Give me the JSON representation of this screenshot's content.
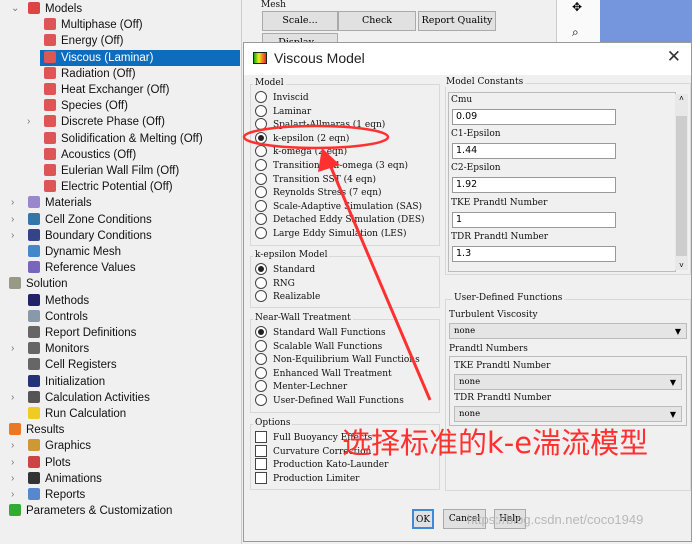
{
  "tree": {
    "items": [
      {
        "label": "Models",
        "icon": "models-icon",
        "indent": 1,
        "chev": "v"
      },
      {
        "label": "Multiphase (Off)",
        "icon": "model-icon",
        "indent": 2
      },
      {
        "label": "Energy (Off)",
        "icon": "model-icon",
        "indent": 2
      },
      {
        "label": "Viscous (Laminar)",
        "icon": "model-icon",
        "indent": 2,
        "selected": true
      },
      {
        "label": "Radiation (Off)",
        "icon": "model-icon",
        "indent": 2
      },
      {
        "label": "Heat Exchanger (Off)",
        "icon": "model-icon",
        "indent": 2
      },
      {
        "label": "Species (Off)",
        "icon": "model-icon",
        "indent": 2
      },
      {
        "label": "Discrete Phase (Off)",
        "icon": "model-icon",
        "indent": 2,
        "chev": ">"
      },
      {
        "label": "Solidification & Melting (Off)",
        "icon": "model-icon",
        "indent": 2
      },
      {
        "label": "Acoustics (Off)",
        "icon": "model-icon",
        "indent": 2
      },
      {
        "label": "Eulerian Wall Film (Off)",
        "icon": "model-icon",
        "indent": 2
      },
      {
        "label": "Electric Potential (Off)",
        "icon": "model-icon",
        "indent": 2
      },
      {
        "label": "Materials",
        "icon": "materials-flask-icon",
        "indent": 1,
        "chev": ">"
      },
      {
        "label": "Cell Zone Conditions",
        "icon": "cell-zone-icon",
        "indent": 1,
        "chev": ">"
      },
      {
        "label": "Boundary Conditions",
        "icon": "boundary-icon",
        "indent": 1,
        "chev": ">"
      },
      {
        "label": "Dynamic Mesh",
        "icon": "dynamic-mesh-icon",
        "indent": 1
      },
      {
        "label": "Reference Values",
        "icon": "reference-values-icon",
        "indent": 1
      },
      {
        "label": "Solution",
        "icon": "solution-icon",
        "indent": 0,
        "chev": "v"
      },
      {
        "label": "Methods",
        "icon": "methods-icon",
        "indent": 1
      },
      {
        "label": "Controls",
        "icon": "controls-icon",
        "indent": 1
      },
      {
        "label": "Report Definitions",
        "icon": "report-icon",
        "indent": 1
      },
      {
        "label": "Monitors",
        "icon": "monitors-icon",
        "indent": 1,
        "chev": ">"
      },
      {
        "label": "Cell Registers",
        "icon": "cell-registers-icon",
        "indent": 1
      },
      {
        "label": "Initialization",
        "icon": "initialization-icon",
        "indent": 1
      },
      {
        "label": "Calculation Activities",
        "icon": "calc-activities-icon",
        "indent": 1,
        "chev": ">"
      },
      {
        "label": "Run Calculation",
        "icon": "lightning-icon",
        "indent": 1
      },
      {
        "label": "Results",
        "icon": "results-icon",
        "indent": 0,
        "chev": "v"
      },
      {
        "label": "Graphics",
        "icon": "graphics-icon",
        "indent": 1,
        "chev": ">"
      },
      {
        "label": "Plots",
        "icon": "plots-icon",
        "indent": 1,
        "chev": ">"
      },
      {
        "label": "Animations",
        "icon": "animations-icon",
        "indent": 1,
        "chev": ">"
      },
      {
        "label": "Reports",
        "icon": "reports-icon",
        "indent": 1,
        "chev": ">"
      },
      {
        "label": "Parameters & Customization",
        "icon": "parameters-icon",
        "indent": 0
      }
    ]
  },
  "mesh": {
    "group": "Mesh",
    "scale": "Scale...",
    "check": "Check",
    "report_quality": "Report Quality",
    "display": "Display..."
  },
  "dialog": {
    "title": "Viscous Model",
    "model": {
      "label": "Model",
      "options": [
        "Inviscid",
        "Laminar",
        "Spalart-Allmaras (1 eqn)",
        "k-epsilon (2 eqn)",
        "k-omega (2 eqn)",
        "Transition k-kl-omega (3 eqn)",
        "Transition SST (4 eqn)",
        "Reynolds Stress (7 eqn)",
        "Scale-Adaptive Simulation (SAS)",
        "Detached Eddy Simulation (DES)",
        "Large Eddy Simulation (LES)"
      ],
      "selected": 3
    },
    "ke_model": {
      "label": "k-epsilon Model",
      "options": [
        "Standard",
        "RNG",
        "Realizable"
      ],
      "selected": 0
    },
    "near_wall": {
      "label": "Near-Wall Treatment",
      "options": [
        "Standard Wall Functions",
        "Scalable Wall Functions",
        "Non-Equilibrium Wall Functions",
        "Enhanced Wall Treatment",
        "Menter-Lechner",
        "User-Defined Wall Functions"
      ],
      "selected": 0
    },
    "options": {
      "label": "Options",
      "items": [
        "Full Buoyancy Effects",
        "Curvature Correction",
        "Production Kato-Launder",
        "Production Limiter"
      ]
    },
    "constants": {
      "label": "Model Constants",
      "fields": [
        {
          "label": "Cmu",
          "value": "0.09"
        },
        {
          "label": "C1-Epsilon",
          "value": "1.44"
        },
        {
          "label": "C2-Epsilon",
          "value": "1.92"
        },
        {
          "label": "TKE Prandtl Number",
          "value": "1"
        },
        {
          "label": "TDR Prandtl Number",
          "value": "1.3"
        }
      ]
    },
    "udf": {
      "label": "User-Defined Functions",
      "turb_visc_label": "Turbulent Viscosity",
      "turb_visc": "none",
      "prandtl_label": "Prandtl Numbers",
      "tke_label": "TKE Prandtl Number",
      "tke": "none",
      "tdr_label": "TDR Prandtl Number",
      "tdr": "none"
    },
    "ok": "OK",
    "cancel": "Cancel",
    "help": "Help"
  },
  "annotation": {
    "text": "选择标准的k-e湍流模型",
    "color": "#ff3030"
  },
  "watermark": "https://blog.csdn.net/coco1949"
}
